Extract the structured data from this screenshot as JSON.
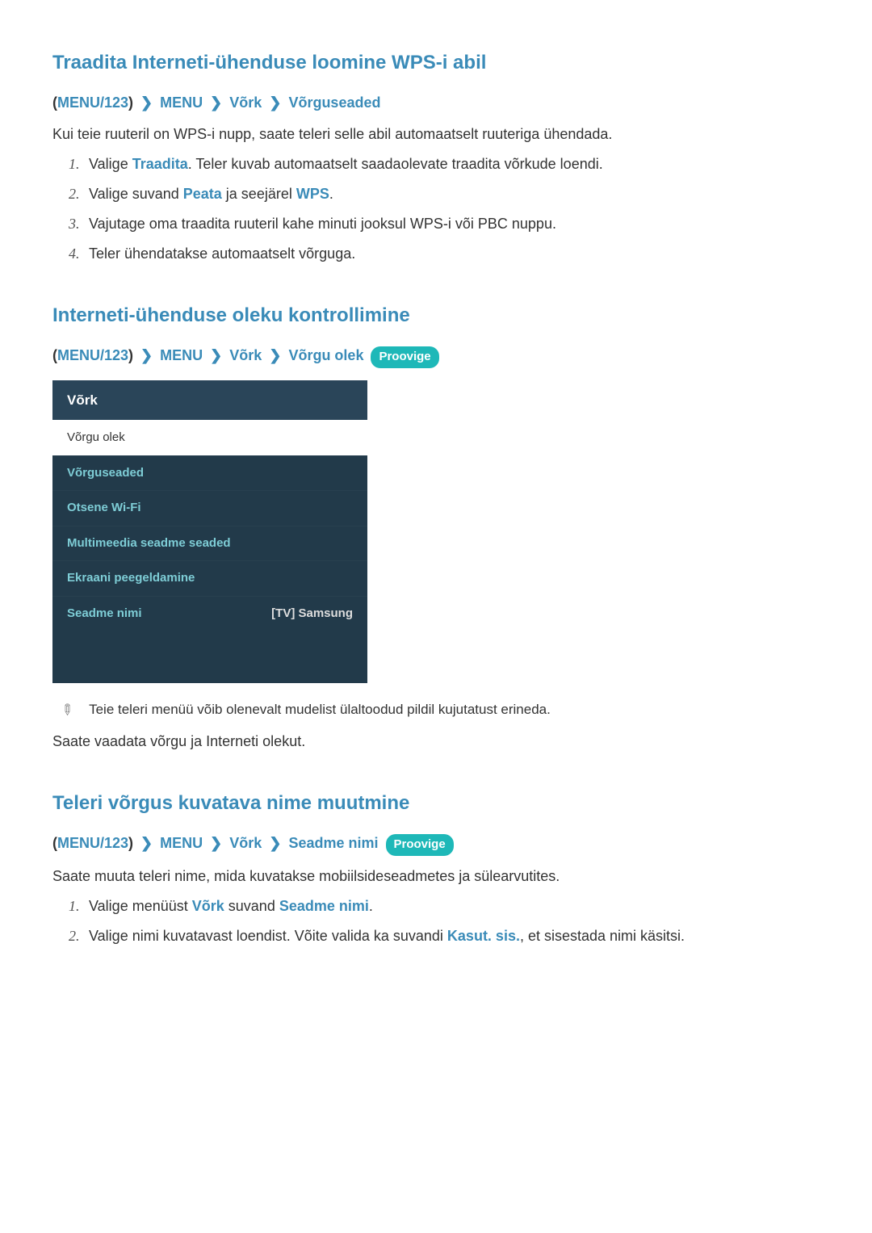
{
  "section1": {
    "title": "Traadita Interneti-ühenduse loomine WPS-i abil",
    "breadcrumb": {
      "part1": "MENU/123",
      "part2": "MENU",
      "part3": "Võrk",
      "part4": "Võrguseaded"
    },
    "intro": "Kui teie ruuteril on WPS-i nupp, saate teleri selle abil automaatselt ruuteriga ühendada.",
    "steps": [
      {
        "prefix": "Valige ",
        "highlight1": "Traadita",
        "suffix": ". Teler kuvab automaatselt saadaolevate traadita võrkude loendi."
      },
      {
        "prefix": "Valige suvand ",
        "highlight1": "Peata",
        "mid": " ja seejärel ",
        "highlight2": "WPS",
        "suffix": "."
      },
      {
        "prefix": "Vajutage oma traadita ruuteril kahe minuti jooksul WPS-i või PBC nuppu."
      },
      {
        "prefix": "Teler ühendatakse automaatselt võrguga."
      }
    ]
  },
  "section2": {
    "title": "Interneti-ühenduse oleku kontrollimine",
    "breadcrumb": {
      "part1": "MENU/123",
      "part2": "MENU",
      "part3": "Võrk",
      "part4": "Võrgu olek"
    },
    "badge": "Proovige",
    "menu": {
      "header": "Võrk",
      "items": [
        {
          "label": "Võrgu olek",
          "selected": true
        },
        {
          "label": "Võrguseaded"
        },
        {
          "label": "Otsene Wi-Fi"
        },
        {
          "label": "Multimeedia seadme seaded"
        },
        {
          "label": "Ekraani peegeldamine"
        },
        {
          "label": "Seadme nimi",
          "value": "[TV] Samsung"
        }
      ]
    },
    "note": "Teie teleri menüü võib olenevalt mudelist ülaltoodud pildil kujutatust erineda.",
    "afterNote": "Saate vaadata võrgu ja Interneti olekut."
  },
  "section3": {
    "title": "Teleri võrgus kuvatava nime muutmine",
    "breadcrumb": {
      "part1": "MENU/123",
      "part2": "MENU",
      "part3": "Võrk",
      "part4": "Seadme nimi"
    },
    "badge": "Proovige",
    "intro": "Saate muuta teleri nime, mida kuvatakse mobiilsideseadmetes ja sülearvutites.",
    "steps": [
      {
        "prefix": "Valige menüüst ",
        "highlight1": "Võrk",
        "mid": " suvand ",
        "highlight2": "Seadme nimi",
        "suffix": "."
      },
      {
        "prefix": "Valige nimi kuvatavast loendist. Võite valida ka suvandi ",
        "highlight1": "Kasut. sis.",
        "suffix": ", et sisestada nimi käsitsi."
      }
    ]
  }
}
